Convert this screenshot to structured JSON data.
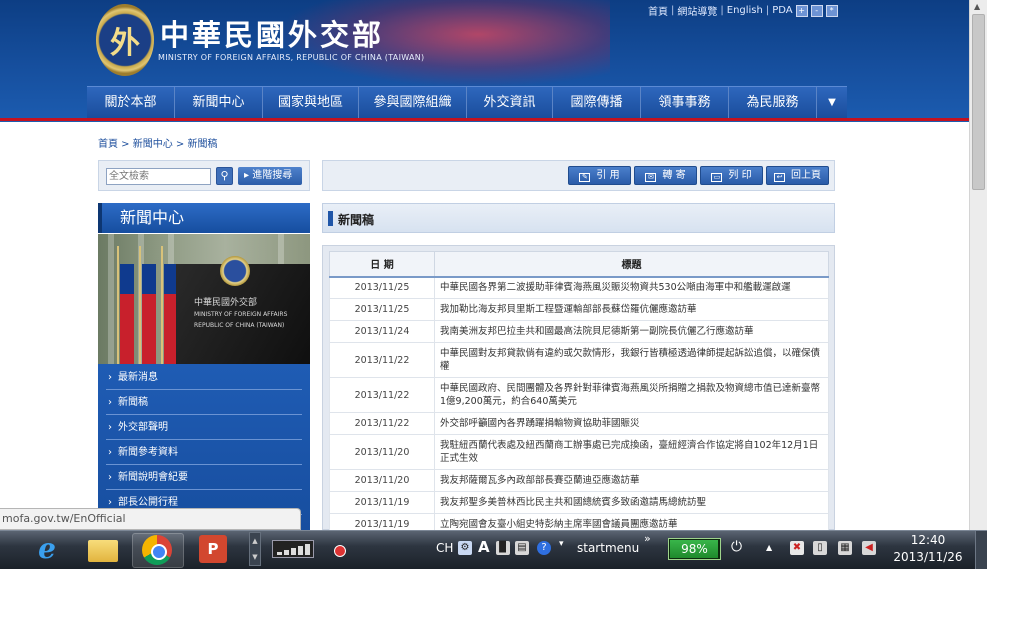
{
  "site": {
    "logo_glyph": "外",
    "title": "中華民國外交部",
    "subtitle": "MINISTRY OF FOREIGN AFFAIRS, REPUBLIC OF CHINA (TAIWAN)",
    "top_links": [
      "首頁",
      "網站導覽",
      "English",
      "PDA"
    ],
    "nav": [
      "關於本部",
      "新聞中心",
      "國家與地區",
      "參與國際組織",
      "外交資訊",
      "國際傳播",
      "領事事務",
      "為民服務"
    ],
    "nav_more": "▼"
  },
  "breadcrumb": "首頁 > 新聞中心 > 新聞稿",
  "search": {
    "placeholder": "全文檢索",
    "button_icon": "⚲",
    "advanced_label": "進階搜尋"
  },
  "toolbar": {
    "cite": "引 用",
    "forward": "轉 寄",
    "print": "列 印",
    "back": "回上頁"
  },
  "sidebar": {
    "title": "新聞中心",
    "photo_text": [
      "中華民國外交部",
      "MINISTRY OF FOREIGN AFFAIRS",
      "REPUBLIC OF CHINA (TAIWAN)"
    ],
    "items": [
      "最新消息",
      "新聞稿",
      "外交部聲明",
      "新聞參考資料",
      "新聞說明會紀要",
      "部長公開行程"
    ]
  },
  "news": {
    "heading": "新聞稿",
    "col_date": "日 期",
    "col_title": "標題",
    "rows": [
      {
        "date": "2013/11/25",
        "title": "中華民國各界第二波援助菲律賓海燕風災賑災物資共530公噸由海軍中和艦載運啟運"
      },
      {
        "date": "2013/11/25",
        "title": "我加勒比海友邦貝里斯工程暨運輸部部長蘇岱羅伉儷應邀訪華"
      },
      {
        "date": "2013/11/24",
        "title": "我南美洲友邦巴拉圭共和國最高法院貝尼德斯第一副院長伉儷乙行應邀訪華"
      },
      {
        "date": "2013/11/22",
        "title": "中華民國對友邦貸款倘有違約或欠款情形，我銀行皆積極透過律師提起訴訟追償，以確保債權"
      },
      {
        "date": "2013/11/22",
        "title": "中華民國政府、民間團體及各界針對菲律賓海燕風災所捐贈之捐款及物資總市值已達新臺幣1億9,200萬元，約合640萬美元"
      },
      {
        "date": "2013/11/22",
        "title": "外交部呼籲國內各界踴躍捐輸物資協助菲國賑災"
      },
      {
        "date": "2013/11/20",
        "title": "我駐紐西蘭代表處及紐西蘭商工辦事處已完成換函，臺紐經濟合作協定將自102年12月1日正式生效"
      },
      {
        "date": "2013/11/20",
        "title": "我友邦薩爾瓦多內政部部長賽亞蘭迪亞應邀訪華"
      },
      {
        "date": "2013/11/19",
        "title": "我友邦聖多美普林西比民主共和國總統賓多致函邀請馬總統訪聖"
      },
      {
        "date": "2013/11/19",
        "title": "立陶宛國會友臺小組史特彭納主席率國會議員團應邀訪華"
      }
    ]
  },
  "browser": {
    "status_url": "mofa.gov.tw/EnOfficial"
  },
  "taskbar": {
    "ime": "CH",
    "ime_mode": "A",
    "startmenu": "startmenu",
    "overflow": "»",
    "battery": {
      "label": "98%",
      "level": 0.98
    },
    "time": "12:40",
    "date": "2013/11/26"
  }
}
